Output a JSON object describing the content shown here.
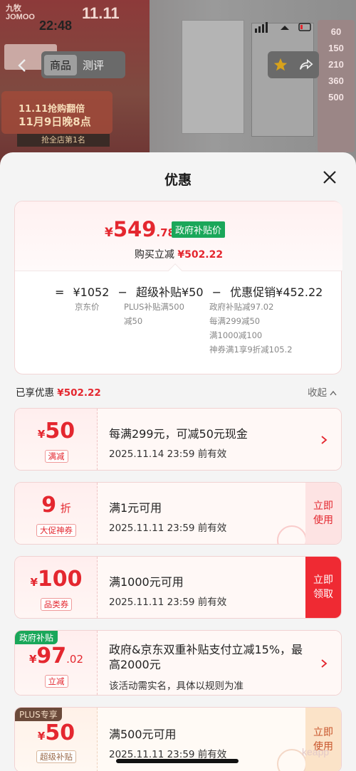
{
  "background": {
    "brand": "九牧\nJOMOO",
    "event": "11.11",
    "time": "22:48",
    "promo_banner_line1": "11.11抢购翻倍",
    "promo_banner_line2": "11月9日晚8点",
    "rank_badge": "抢全店第1名",
    "price_column": [
      "60",
      "150",
      "210",
      "360",
      "500"
    ],
    "nav_tabs": [
      "商品",
      "测评"
    ]
  },
  "sheet": {
    "title": "优惠",
    "price_card": {
      "final_price_symbol": "¥",
      "final_price_int": "549",
      "final_price_dec": ".78",
      "gov_tag": "政府补贴价",
      "instant_label": "购买立减",
      "instant_value": "¥502.22",
      "formula": {
        "eq": "=",
        "base": "¥1052",
        "minus1": "−",
        "super": "超级补贴¥50",
        "minus2": "−",
        "promo": "优惠促销¥452.22"
      },
      "base_label": "京东价",
      "super_detail_1": "PLUS补贴满500",
      "super_detail_2": "减50",
      "promo_details": [
        "政府补贴减97.02",
        "每满299减50",
        "满1000减100",
        "神券满1享9折减105.2"
      ]
    },
    "enjoyed_label": "已享优惠",
    "enjoyed_value": "¥502.22",
    "collapse_label": "收起",
    "coupons": [
      {
        "symbol": "¥",
        "amount": "50",
        "type": "满减",
        "main": "每满299元，可减50元现金",
        "sub": "2025.11.14 23:59 前有效"
      },
      {
        "amount": "9",
        "unit": "折",
        "type": "大促神券",
        "main": "满1元可用",
        "sub": "2025.11.11 23:59 前有效",
        "action": "立即\n使用"
      },
      {
        "symbol": "¥",
        "amount": "100",
        "type": "品类券",
        "main": "满1000元可用",
        "sub": "2025.11.11 23:59 前有效",
        "action": "立即\n领取"
      },
      {
        "tag": "政府补贴",
        "symbol": "¥",
        "amount": "97",
        "decimal": ".02",
        "type": "立减",
        "main_line1": "政府&京东双重补贴支付立减15%，最",
        "main_line2": "高2000元",
        "sub": "该活动需实名，具体以规则为准"
      },
      {
        "tag": "PLUS专享",
        "symbol": "¥",
        "amount": "50",
        "type": "超级补贴",
        "main": "满500元可用",
        "sub": "2025.11.11 23:59 前有效",
        "action": "立即\n使用"
      }
    ],
    "watermark": "keapp"
  },
  "colors": {
    "accent_red": "#e4272f",
    "gov_green": "#1aa75a",
    "plus_brown": "#6b4a3a"
  }
}
